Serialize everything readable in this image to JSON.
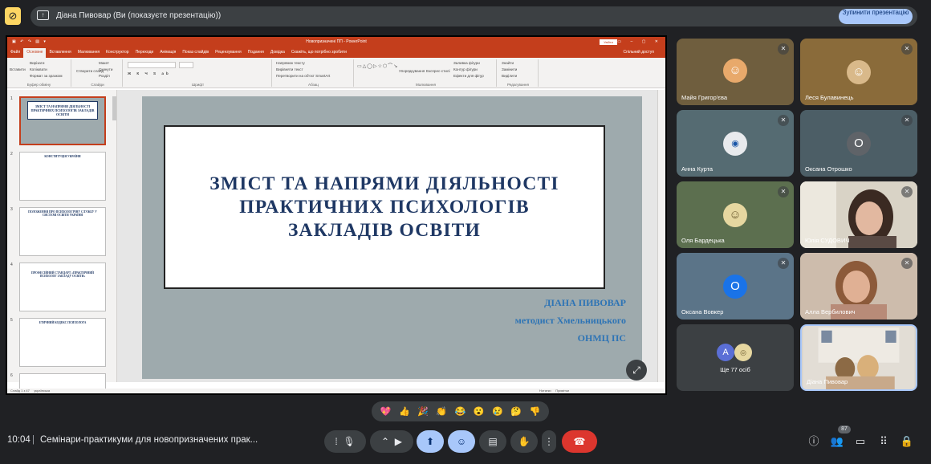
{
  "presenting_bar": {
    "label": "Діана Пивовар (Ви (показуєте презентацію))",
    "stop_button": "Зупинити презентацію"
  },
  "powerpoint": {
    "window_title": "Новопризначені ПП - PowerPoint",
    "save_state": "Увійти",
    "menu_tabs": [
      "Файл",
      "Основне",
      "Вставлення",
      "Малювання",
      "Конструктор",
      "Переходи",
      "Анімація",
      "Показ слайдів",
      "Рецензування",
      "Подання",
      "Довідка",
      "Скажіть, що потрібно зробити"
    ],
    "active_tab": "Основне",
    "share": "Спільний доступ",
    "ribbon": {
      "paste": "Вставити",
      "cut": "Вирізати",
      "copy": "Копіювати",
      "format_painter": "Формат за зразком",
      "clipboard": "Буфер обміну",
      "new_slide": "Створити слайд",
      "layout": "Макет",
      "reset": "Скинути",
      "section": "Розділ",
      "slides": "Слайди",
      "font": "Шрифт",
      "text_direction": "Напрямок тексту",
      "align_text": "Вирівняти текст",
      "smartart": "Перетворити на об'єкт SmartArt",
      "paragraph": "Абзац",
      "arrange": "Упорядкування",
      "quick_styles": "Експрес-стилі",
      "shape_fill": "Заливка фігури",
      "shape_outline": "Контур фігури",
      "shape_effects": "Ефекти для фігур",
      "drawing": "Малювання",
      "find": "Знайти",
      "replace": "Замінити",
      "select": "Виділити",
      "editing": "Редагування"
    },
    "thumbnails": [
      {
        "num": "1",
        "title": "ЗМІСТ ТА НАПРЯМИ ДІЯЛЬНОСТІ ПРАКТИЧНИХ ПСИХОЛОГІВ ЗАКЛАДІВ ОСВІТИ"
      },
      {
        "num": "2",
        "title": "КОНСТИТУЦІЯ УКРАЇНИ"
      },
      {
        "num": "3",
        "title": "ПОЛОЖЕННЯ ПРО ПСИХОЛОГІЧНУ СЛУЖБУ У СИСТЕМІ ОСВІТИ УКРАЇНИ"
      },
      {
        "num": "4",
        "title": "ПРОФЕСІЙНИЙ СТАНДАРТ «ПРАКТИЧНИЙ ПСИХОЛОГ ЗАКЛАДУ ОСВІТИ»"
      },
      {
        "num": "5",
        "title": "ЕТИЧНИЙ КОДЕКС ПСИХОЛОГА"
      },
      {
        "num": "6",
        "title": ""
      }
    ],
    "slide": {
      "title_lines": [
        "ЗМІСТ ТА НАПРЯМИ ДІЯЛЬНОСТІ",
        "ПРАКТИЧНИХ ПСИХОЛОГІВ",
        "ЗАКЛАДІВ ОСВІТИ"
      ],
      "author": "ДІАНА ПИВОВАР",
      "position": "методист Хмельницького",
      "org": "ОНМЦ ПС"
    },
    "status": {
      "slide_counter": "Слайд 1 з 47",
      "language": "українська",
      "notes": "Нотатки",
      "comments": "Примітки"
    }
  },
  "participants": [
    {
      "name": "Майя Григор'єва",
      "muted": true,
      "kind": "avatar-photo"
    },
    {
      "name": "Леся Булавинець",
      "muted": true,
      "kind": "avatar-photo"
    },
    {
      "name": "Анна Курта",
      "muted": true,
      "kind": "avatar-logo"
    },
    {
      "name": "Оксана Отрошко",
      "muted": true,
      "kind": "letter",
      "letter": "О"
    },
    {
      "name": "Оля Бардецька",
      "muted": true,
      "kind": "avatar-photo"
    },
    {
      "name": "Юлія СУДОВИЧ",
      "muted": true,
      "kind": "video"
    },
    {
      "name": "Оксана Вовкер",
      "muted": true,
      "kind": "letter",
      "letter": "О"
    },
    {
      "name": "Алла Вербилович",
      "muted": true,
      "kind": "video"
    },
    {
      "name": "Ще 77 осіб",
      "kind": "more",
      "letter": "А"
    },
    {
      "name": "Діана Пивовар",
      "kind": "self-video"
    }
  ],
  "reactions": [
    "💖",
    "👍",
    "🎉",
    "👏",
    "😂",
    "😮",
    "😢",
    "🤔",
    "👎"
  ],
  "bottom_bar": {
    "time": "10:04",
    "separator": "|",
    "meeting_title": "Семінари-практикуми для новопризначених прак...",
    "people_count": "87"
  },
  "colors": {
    "accent": "#a8c7fa",
    "hangup": "#dc362e",
    "ppt_red": "#c43e1c",
    "slide_title": "#1f3864",
    "slide_author": "#2e74b5"
  }
}
